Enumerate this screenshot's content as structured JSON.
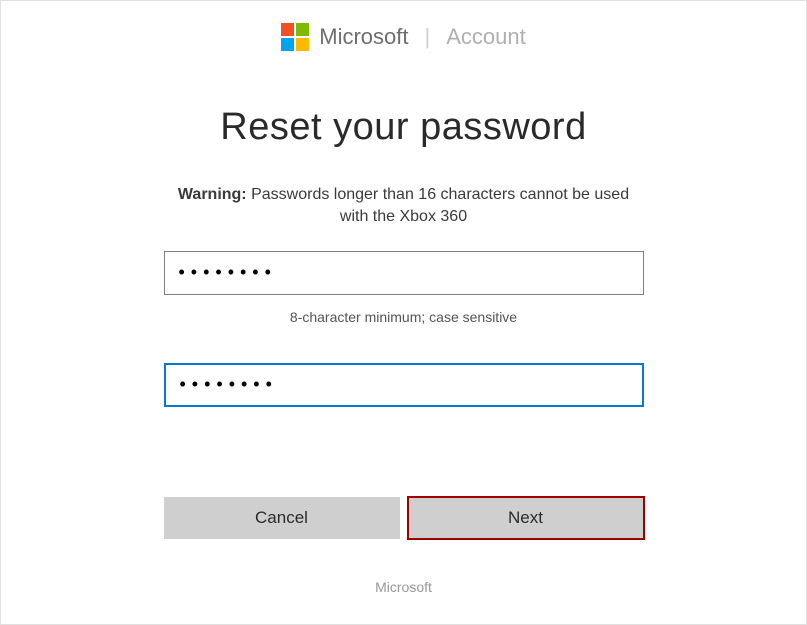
{
  "header": {
    "brand": "Microsoft",
    "section": "Account"
  },
  "main": {
    "title": "Reset your password",
    "warning_label": "Warning:",
    "warning_text": " Passwords longer than 16 characters cannot be used with the Xbox 360",
    "password1_value": "••••••••",
    "hint": "8-character minimum; case sensitive",
    "password2_value": "••••••••",
    "cancel_label": "Cancel",
    "next_label": "Next"
  },
  "footer": {
    "text": "Microsoft"
  }
}
